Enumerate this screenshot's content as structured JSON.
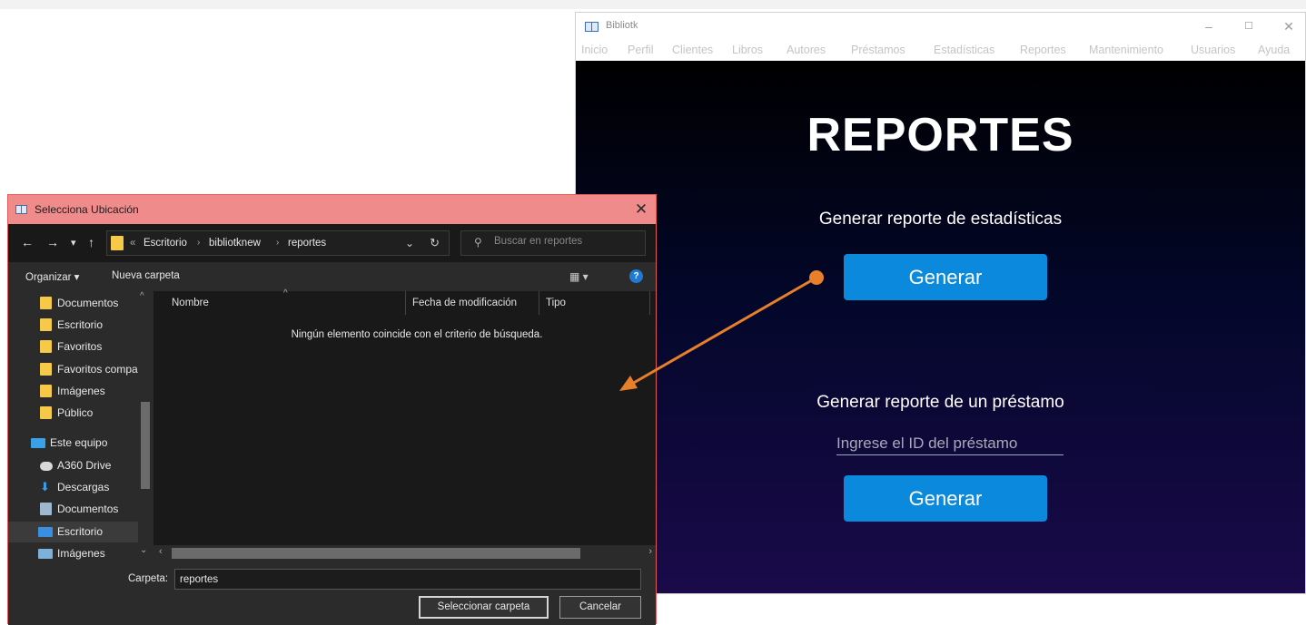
{
  "app": {
    "title": "Bibliotk",
    "menu": [
      "Inicio",
      "Perfil",
      "Clientes",
      "Libros",
      "Autores",
      "Préstamos",
      "Estadísticas",
      "Reportes",
      "Mantenimiento",
      "Usuarios",
      "Ayuda"
    ],
    "window_controls": {
      "minimize": "–",
      "maximize": "☐",
      "close": "✕"
    },
    "heading": "REPORTES",
    "stats_label": "Generar reporte de estadísticas",
    "stats_button": "Generar",
    "loan_label": "Generar reporte de un préstamo",
    "loan_input_placeholder": "Ingrese el ID del préstamo",
    "loan_button": "Generar"
  },
  "dialog": {
    "title": "Selecciona Ubicación",
    "close": "✕",
    "nav": {
      "back": "←",
      "forward": "→",
      "recent": "▾",
      "up": "↑"
    },
    "breadcrumb_overflow": "«",
    "breadcrumb": [
      "Escritorio",
      "bibliotknew",
      "reportes"
    ],
    "breadcrumb_sep": "›",
    "search_placeholder": "Buscar en reportes",
    "organize": "Organizar ▾",
    "new_folder": "Nueva carpeta",
    "nav_items": [
      {
        "label": "Documentos",
        "icon": "folder-icon"
      },
      {
        "label": "Escritorio",
        "icon": "folder-icon"
      },
      {
        "label": "Favoritos",
        "icon": "folder-icon"
      },
      {
        "label": "Favoritos compa",
        "icon": "folder-icon"
      },
      {
        "label": "Imágenes",
        "icon": "folder-icon"
      },
      {
        "label": "Público",
        "icon": "folder-icon"
      },
      {
        "label": "Este equipo",
        "icon": "computer-icon"
      },
      {
        "label": "A360 Drive",
        "icon": "cloud-drive-icon"
      },
      {
        "label": "Descargas",
        "icon": "download-icon"
      },
      {
        "label": "Documentos",
        "icon": "documents-icon"
      },
      {
        "label": "Escritorio",
        "icon": "desktop-icon"
      },
      {
        "label": "Imágenes",
        "icon": "pictures-icon"
      }
    ],
    "columns": [
      "Nombre",
      "Fecha de modificación",
      "Tipo"
    ],
    "empty_message": "Ningún elemento coincide con el criterio de búsqueda.",
    "folder_label": "Carpeta:",
    "folder_value": "reportes",
    "select_button": "Seleccionar carpeta",
    "cancel_button": "Cancelar"
  },
  "colors": {
    "accent_button": "#0b89dc",
    "dialog_titlebar": "#f08b8b",
    "annotation": "#e87f2a"
  }
}
